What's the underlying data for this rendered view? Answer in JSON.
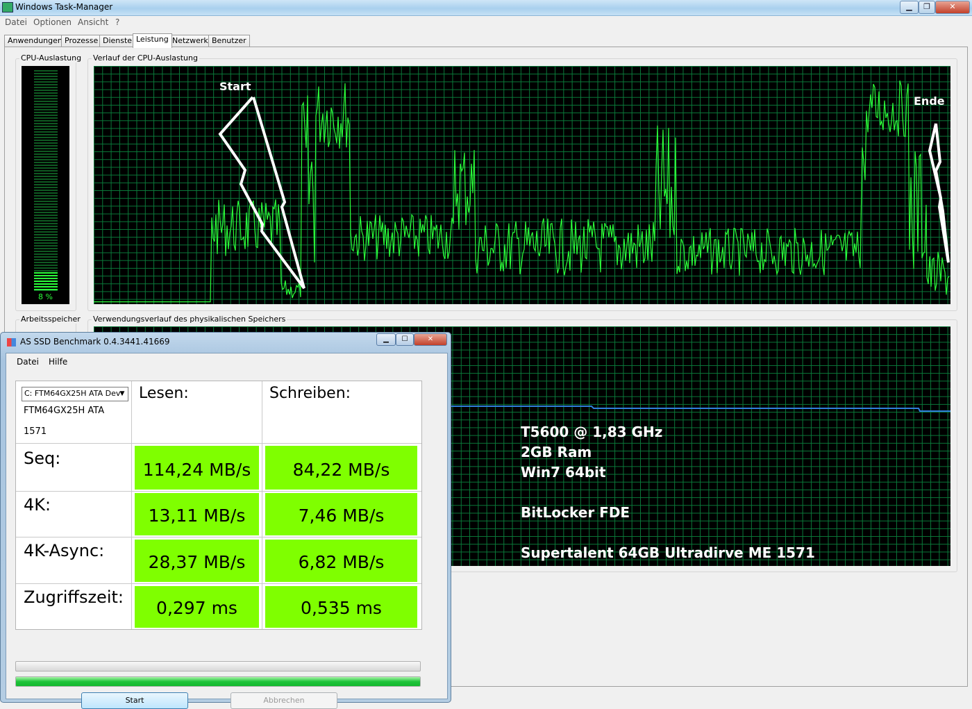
{
  "taskmanager": {
    "title": "Windows Task-Manager",
    "menu": [
      "Datei",
      "Optionen",
      "Ansicht",
      "?"
    ],
    "tabs": [
      "Anwendungen",
      "Prozesse",
      "Dienste",
      "Leistung",
      "Netzwerk",
      "Benutzer"
    ],
    "active_tab": "Leistung",
    "cpu_usage_label": "CPU-Auslastung",
    "cpu_usage_value": "8 %",
    "cpu_usage_level": 0.08,
    "cpu_history_label": "Verlauf der CPU-Auslastung",
    "memory_label": "Arbeitsspeicher",
    "memory_history_label": "Verwendungsverlauf des physikalischen Speichers",
    "annotations": {
      "start": "Start",
      "end": "Ende"
    },
    "system_info": [
      "T5600 @ 1,83 GHz",
      "2GB Ram",
      "Win7 64bit",
      "BitLocker FDE",
      "Supertalent 64GB Ultradirve ME 1571"
    ],
    "colors": {
      "cpu_line": "#2bff3a",
      "memory_line": "#2f7fdc",
      "grid": "#0a7a3a"
    }
  },
  "as_ssd": {
    "title": "AS SSD Benchmark 0.4.3441.41669",
    "menu": [
      "Datei",
      "Hilfe"
    ],
    "drive_select": "C: FTM64GX25H ATA Dev",
    "drive_model": "FTM64GX25H ATA",
    "drive_firmware": "1571",
    "col_read": "Lesen:",
    "col_write": "Schreiben:",
    "rows": [
      {
        "label": "Seq:",
        "read": "114,24 MB/s",
        "write": "84,22 MB/s"
      },
      {
        "label": "4K:",
        "read": "13,11 MB/s",
        "write": "7,46 MB/s"
      },
      {
        "label": "4K-Async:",
        "read": "28,37 MB/s",
        "write": "6,82 MB/s"
      },
      {
        "label": "Zugriffszeit:",
        "read": "0,297 ms",
        "write": "0,535 ms"
      }
    ],
    "progress_total": 1.0,
    "start_button": "Start",
    "abort_button": "Abbrechen",
    "colors": {
      "result_bg": "#7fff00"
    }
  }
}
